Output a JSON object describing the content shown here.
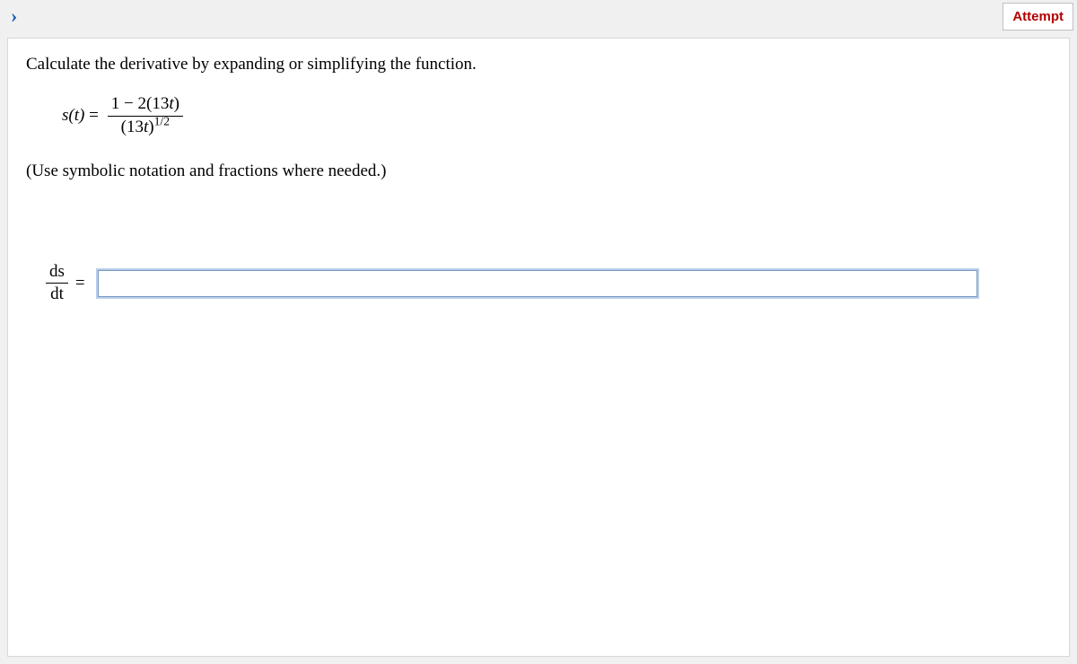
{
  "header": {
    "chevron_glyph": "›",
    "attempt_label": "Attempt"
  },
  "question": {
    "prompt": "Calculate the derivative by expanding or simplifying the function.",
    "equation": {
      "lhs": "s(t)",
      "numerator_parts": {
        "prefix": "1 − 2(13",
        "t": "t",
        "suffix": ")"
      },
      "denominator_parts": {
        "prefix": "(13",
        "t": "t",
        "suffix": ")",
        "exponent": "1/2"
      }
    },
    "hint": "(Use symbolic notation and fractions where needed.)",
    "answer_label": {
      "num": "ds",
      "den": "dt"
    },
    "answer_value": ""
  }
}
